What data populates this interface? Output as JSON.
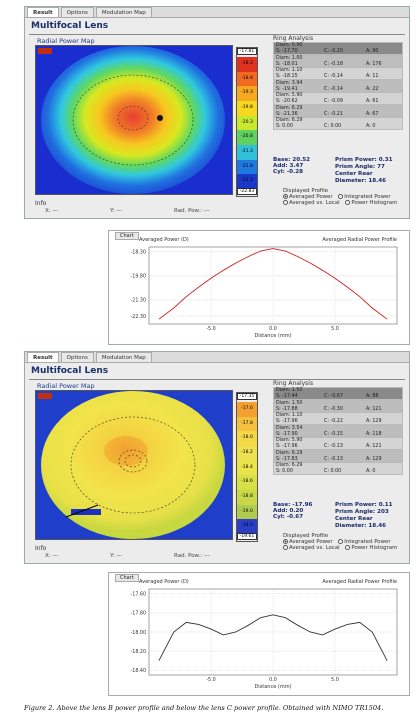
{
  "panelA": {
    "tabs": [
      "Result",
      "Options",
      "Modulation Map"
    ],
    "title": "Multifocal Lens",
    "map_label": "Radial Power Map",
    "scale_top": "-17.81",
    "scale_bottom": "-22.83",
    "scale_labels": [
      "-18.3",
      "-18.8",
      "-19.3",
      "-19.8",
      "-20.3",
      "-20.8",
      "-21.3",
      "-21.8",
      "-22.3"
    ],
    "ring_title": "Ring Analysis",
    "rings": [
      {
        "diam": "Diam: 0.90",
        "s": "S: -17.70",
        "c": "C: -0.20",
        "a": "A: 90"
      },
      {
        "diam": "Diam: 1.00",
        "s": "S: -18.01",
        "c": "C: -0.18",
        "a": "A: 176"
      },
      {
        "diam": "Diam: 1.10",
        "s": "S: -18.15",
        "c": "C: -0.14",
        "a": "A: 11"
      },
      {
        "diam": "Diam: 3.94",
        "s": "S: -19.41",
        "c": "C: -0.14",
        "a": "A: 22"
      },
      {
        "diam": "Diam: 5.90",
        "s": "S: -20.62",
        "c": "C: -0.09",
        "a": "A: 61"
      },
      {
        "diam": "Diam: 6.29",
        "s": "S: -21.36",
        "c": "C: -0.21",
        "a": "A: 67"
      },
      {
        "diam": "Diam: 6.29",
        "s": "S: 0.00",
        "c": "C: 0.00",
        "a": "A: 0"
      }
    ],
    "stats": {
      "base": "Base:  20.52",
      "add": "Add:  3.47",
      "cyl": "Cyl:  -0.28",
      "prism_power": "Prism Power:  0.31",
      "prism_angle": "Prism Angle:   77",
      "center": "Center Rear",
      "diameter": "Diameter:  18.46"
    },
    "displayed_profile": "Displayed Profile",
    "options": [
      "Averaged Power",
      "Integrated Power",
      "Averaged vs. Local",
      "Power Histogram"
    ],
    "info": "Info",
    "x_label": "X: ---",
    "y_label": "Y: ---",
    "rad_label": "Rad. Pow.: ---"
  },
  "chartA": {
    "tab": "Chart",
    "left_title": "Averaged Power (D)",
    "right_title": "Averaged Radial Power Profile",
    "xlabel": "Distance (mm)"
  },
  "panelB": {
    "tabs": [
      "Result",
      "Options",
      "Modulation Map"
    ],
    "title": "Multifocal Lens",
    "map_label": "Radial Power Map",
    "scale_top": "-17.35",
    "scale_bottom": "-19.61",
    "scale_labels": [
      "-17.6",
      "-17.8",
      "-18.0",
      "-18.2",
      "-18.4",
      "-18.6",
      "-18.8",
      "-19.0",
      "-19.2"
    ],
    "ring_title": "Ring Analysis",
    "rings": [
      {
        "diam": "Diam: 1.50",
        "s": "S: -17.44",
        "c": "C: -0.67",
        "a": "A: 88"
      },
      {
        "diam": "Diam: 1.50",
        "s": "S: -17.88",
        "c": "C: -0.30",
        "a": "A: 121"
      },
      {
        "diam": "Diam: 1.10",
        "s": "S: -17.96",
        "c": "C: -0.22",
        "a": "A: 129"
      },
      {
        "diam": "Diam: 3.54",
        "s": "S: -17.90",
        "c": "C: -0.15",
        "a": "A: 118"
      },
      {
        "diam": "Diam: 5.90",
        "s": "S: -17.96",
        "c": "C: -0.13",
        "a": "A: 121"
      },
      {
        "diam": "Diam: 6.29",
        "s": "S: -17.83",
        "c": "C: -0.13",
        "a": "A: 129"
      },
      {
        "diam": "Diam: 6.29",
        "s": "S: 0.00",
        "c": "C: 0.00",
        "a": "A: 0"
      }
    ],
    "stats": {
      "base": "Base:  -17.96",
      "add": "Add:  0.20",
      "cyl": "Cyl:  -0.67",
      "prism_power": "Prism Power:  0.11",
      "prism_angle": "Prism Angle:  203",
      "center": "Center Rear",
      "diameter": "Diameter:  18.46"
    },
    "displayed_profile": "Displayed Profile",
    "options": [
      "Averaged Power",
      "Integrated Power",
      "Averaged vs. Local",
      "Power Histogram"
    ],
    "info": "Info",
    "x_label": "X: ---",
    "y_label": "Y: ---",
    "rad_label": "Rad. Pow.: ---"
  },
  "chartB": {
    "tab": "Chart",
    "left_title": "Averaged Power (D)",
    "right_title": "Averaged Radial Power Profile",
    "xlabel": "Distance (mm)"
  },
  "caption": "Figure 2. Above the lens B power profile and below the lens C power profile. Obtained with NIMO TR1504.",
  "chart_data": [
    {
      "type": "line",
      "title": "Averaged Radial Power Profile",
      "ylabel": "Averaged Power (D)",
      "xlabel": "Distance (mm)",
      "xlim": [
        -10,
        10
      ],
      "ylim": [
        -22.8,
        -18.0
      ],
      "yticks": [
        -18.3,
        -19.8,
        -21.3,
        -22.3
      ],
      "xticks": [
        -5.0,
        0.0,
        5.0
      ],
      "x": [
        -9.2,
        -8,
        -7,
        -6,
        -5,
        -4,
        -3,
        -2,
        -1,
        0,
        1,
        2,
        3,
        4,
        5,
        6,
        7,
        8,
        9.2
      ],
      "series": [
        {
          "values": [
            -22.5,
            -21.8,
            -21.1,
            -20.5,
            -19.95,
            -19.45,
            -19.0,
            -18.6,
            -18.25,
            -18.1,
            -18.25,
            -18.6,
            -19.0,
            -19.45,
            -19.95,
            -20.5,
            -21.1,
            -21.8,
            -22.5
          ]
        }
      ],
      "color": "#d02020"
    },
    {
      "type": "line",
      "title": "Averaged Radial Power Profile",
      "ylabel": "Averaged Power (D)",
      "xlabel": "Distance (mm)",
      "xlim": [
        -10,
        10
      ],
      "ylim": [
        -18.45,
        -17.55
      ],
      "yticks": [
        -17.6,
        -17.8,
        -18.0,
        -18.2,
        -18.4
      ],
      "xticks": [
        -5.0,
        0.0,
        5.0
      ],
      "x": [
        -9.2,
        -8,
        -7,
        -6,
        -5,
        -4,
        -3,
        -2,
        -1,
        0,
        1,
        2,
        3,
        4,
        5,
        6,
        7,
        8,
        9.2
      ],
      "series": [
        {
          "values": [
            -18.3,
            -18.0,
            -17.9,
            -17.92,
            -17.97,
            -18.03,
            -18.0,
            -17.93,
            -17.85,
            -17.82,
            -17.85,
            -17.93,
            -18.0,
            -18.03,
            -17.97,
            -17.92,
            -17.9,
            -18.0,
            -18.3
          ]
        }
      ],
      "color": "#333333"
    }
  ]
}
